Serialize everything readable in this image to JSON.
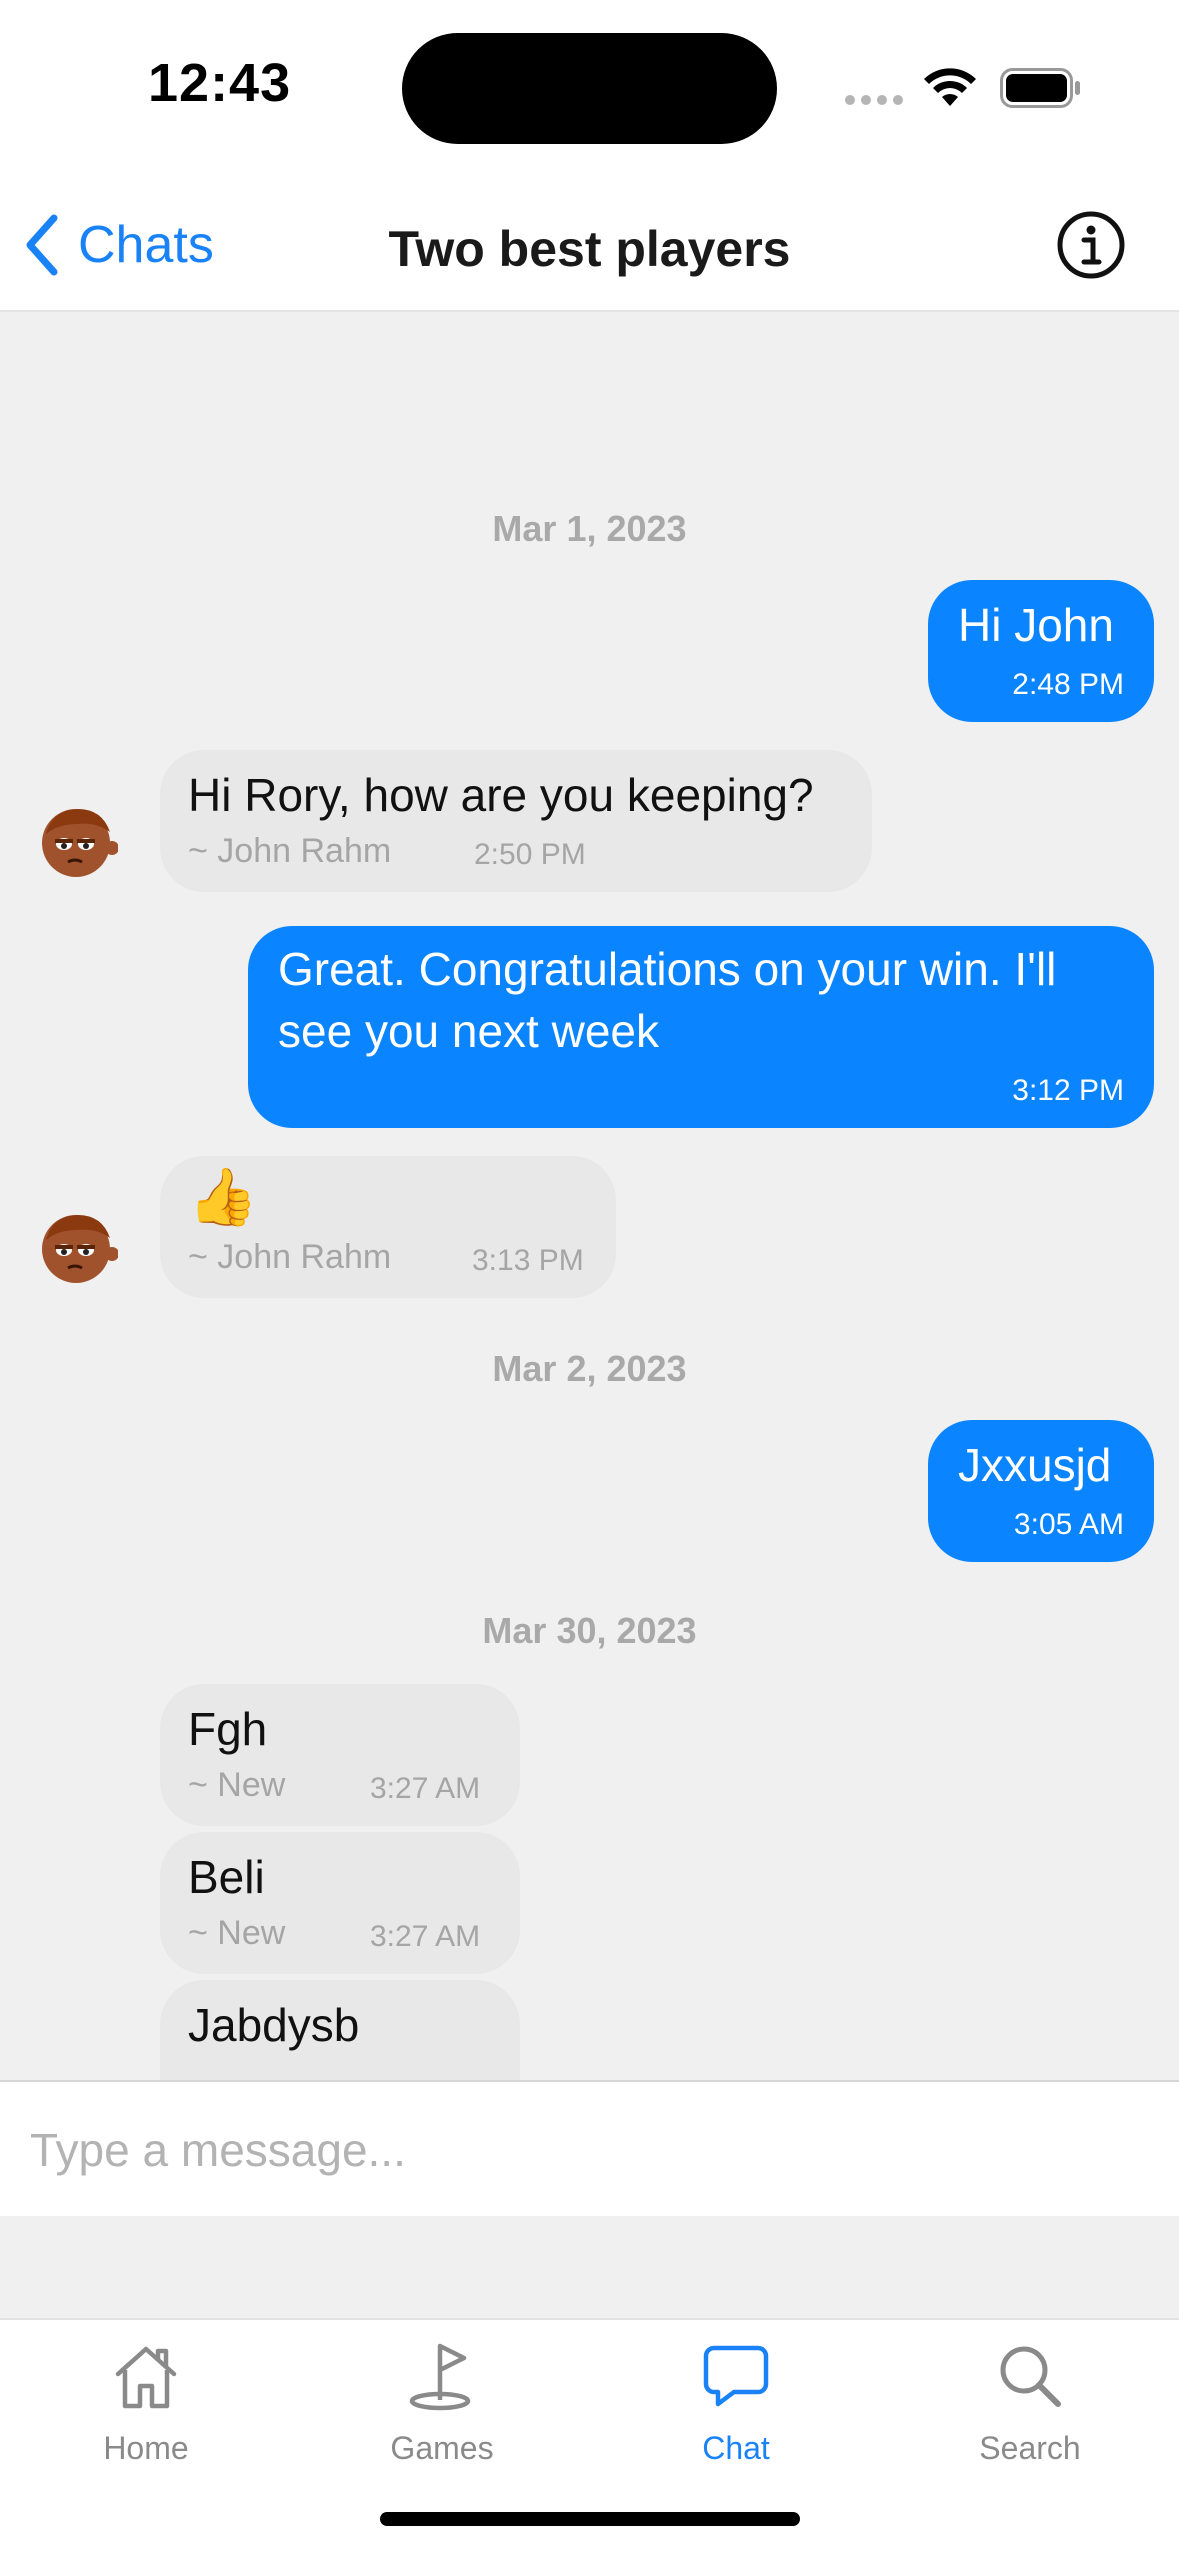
{
  "status_bar": {
    "time": "12:43"
  },
  "nav": {
    "back_label": "Chats",
    "title": "Two best players"
  },
  "messages": [
    {
      "type": "date",
      "label": "Mar 1, 2023"
    },
    {
      "type": "outgoing",
      "text": "Hi John",
      "time": "2:48 PM"
    },
    {
      "type": "incoming",
      "text": "Hi Rory, how are you keeping?",
      "sender": "~ John Rahm",
      "time": "2:50 PM"
    },
    {
      "type": "outgoing",
      "text": "Great. Congratulations on your win. I'll see you next week",
      "time": "3:12 PM"
    },
    {
      "type": "incoming",
      "text": "👍",
      "sender": "~ John Rahm",
      "time": "3:13 PM"
    },
    {
      "type": "date",
      "label": "Mar 2, 2023"
    },
    {
      "type": "outgoing",
      "text": "Jxxusjd",
      "time": "3:05 AM"
    },
    {
      "type": "date",
      "label": "Mar 30, 2023"
    },
    {
      "type": "incoming",
      "text": "Fgh",
      "sender": "~ New",
      "time": "3:27 AM"
    },
    {
      "type": "incoming",
      "text": "Beli",
      "sender": "~ New",
      "time": "3:27 AM"
    },
    {
      "type": "incoming",
      "text": "Jabdysb",
      "sender": "",
      "time": ""
    }
  ],
  "composer": {
    "placeholder": "Type a message..."
  },
  "tabs": [
    {
      "label": "Home",
      "icon": "house-icon",
      "active": false
    },
    {
      "label": "Games",
      "icon": "golf-flag-icon",
      "active": false
    },
    {
      "label": "Chat",
      "icon": "chat-bubble-icon",
      "active": true
    },
    {
      "label": "Search",
      "icon": "magnifier-icon",
      "active": false
    }
  ],
  "colors": {
    "accent": "#1a82f7",
    "outgoing_bubble": "#0a84ff",
    "incoming_bubble": "#e8e8e8",
    "background": "#f0f0f0"
  }
}
